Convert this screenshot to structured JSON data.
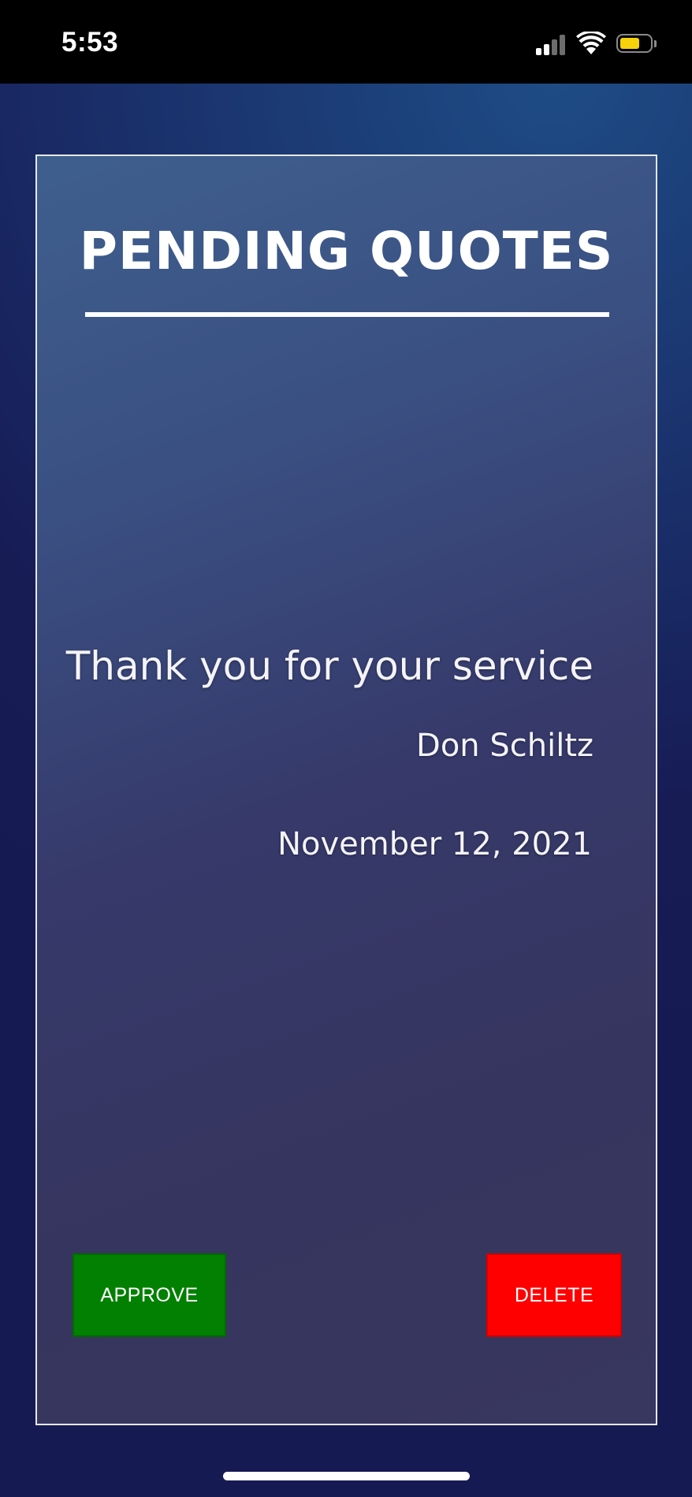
{
  "status_bar": {
    "time": "5:53",
    "battery_color": "#f5d20b"
  },
  "card": {
    "title": "PENDING QUOTES",
    "message": "Thank you for your service",
    "signer": "Don Schiltz",
    "date": "November 12, 2021"
  },
  "actions": {
    "approve_label": "APPROVE",
    "approve_color": "#028001",
    "delete_label": "DELETE",
    "delete_color": "#ff0000"
  }
}
